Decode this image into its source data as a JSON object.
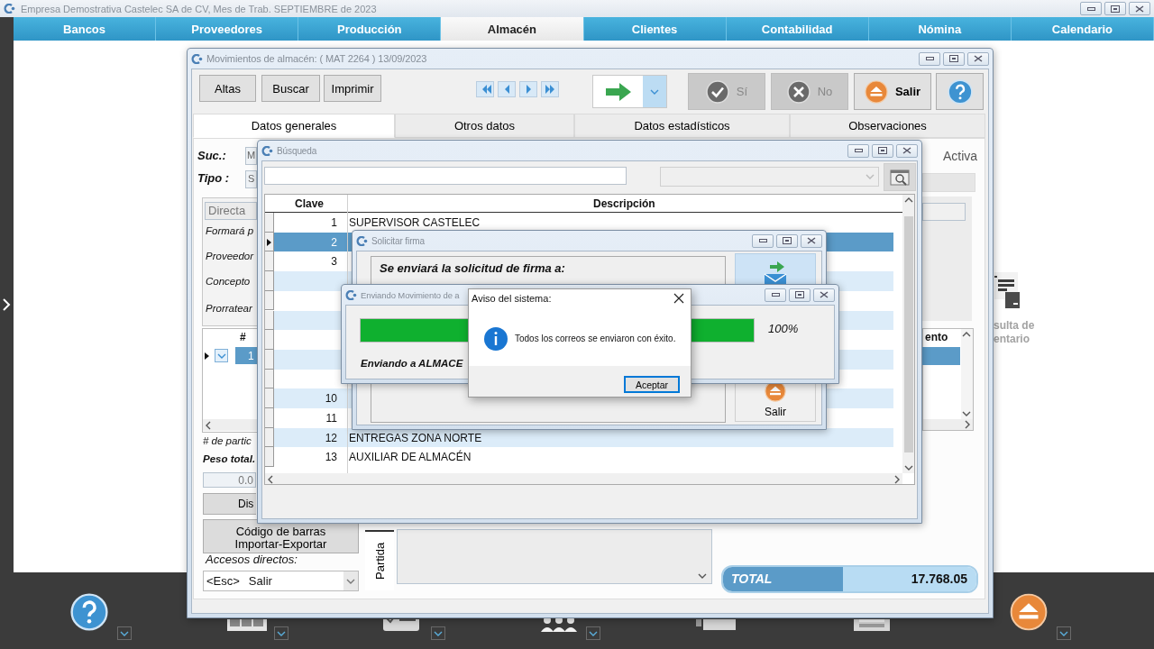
{
  "app_title": "Empresa Demostrativa Castelec SA de CV, Mes de Trab. SEPTIEMBRE de 2023",
  "menu": [
    {
      "label": "Bancos",
      "selected": false
    },
    {
      "label": "Proveedores",
      "selected": false
    },
    {
      "label": "Producción",
      "selected": false
    },
    {
      "label": "Almacén",
      "selected": true
    },
    {
      "label": "Clientes",
      "selected": false
    },
    {
      "label": "Contabilidad",
      "selected": false
    },
    {
      "label": "Nómina",
      "selected": false
    },
    {
      "label": "Calendario",
      "selected": false
    }
  ],
  "shortcut": {
    "lines": [
      "sulta de",
      "entario"
    ]
  },
  "main_window": {
    "title": "Movimientos de almacén: ( MAT 2264 )  13/09/2023",
    "toolbar": [
      "Altas",
      "Buscar",
      "Imprimir"
    ],
    "actions": [
      {
        "kind": "check",
        "label": "Sí",
        "disabled": true
      },
      {
        "kind": "cross",
        "label": "No",
        "disabled": true
      },
      {
        "kind": "eject",
        "label": "Salir",
        "disabled": false
      }
    ],
    "tabs": [
      {
        "label": "Datos generales",
        "selected": true
      },
      {
        "label": "Otros datos",
        "selected": false
      },
      {
        "label": "Datos estadísticos",
        "selected": false
      },
      {
        "label": "Observaciones",
        "selected": false
      }
    ],
    "suc": {
      "label": "Suc.:",
      "value": "M"
    },
    "tipo": {
      "label": "Tipo :",
      "value": "S"
    },
    "status": "Activa",
    "group": {
      "value": "Directa",
      "labels": [
        "Formará p",
        "Proveedor",
        "Concepto",
        "Prorratear"
      ]
    },
    "items_grid": {
      "columns": [
        "#",
        "ento"
      ],
      "rows": [
        {
          "number": "1",
          "selected": true,
          "checked": true
        }
      ]
    },
    "partidas_label": "# de partic",
    "peso_label": "Peso total.",
    "peso_value": "0.0",
    "dis_button": "Dis",
    "barcode_button": [
      "Código de barras",
      "Importar-Exportar"
    ],
    "shortcuts": {
      "label": "Accesos directos:",
      "key": "<Esc>",
      "action": "Salir"
    },
    "side_tab": "Partida",
    "total": {
      "label": "TOTAL",
      "value": "17.768.05"
    }
  },
  "search_window": {
    "title": "Búsqueda",
    "columns": [
      "Clave",
      "Descripción"
    ],
    "rows": [
      {
        "clave": "1",
        "descripcion": "SUPERVISOR CASTELEC",
        "selected": false
      },
      {
        "clave": "2",
        "selected": true
      },
      {
        "clave": "3",
        "selected": false
      },
      {
        "selected": false
      },
      {
        "selected": false
      },
      {
        "selected": false
      },
      {
        "selected": false
      },
      {
        "selected": false
      },
      {
        "selected": false
      },
      {
        "clave": "10",
        "selected": false
      },
      {
        "clave": "11",
        "selected": false
      },
      {
        "clave": "12",
        "descripcion": "ENTREGAS ZONA NORTE",
        "selected": false
      },
      {
        "clave": "13",
        "descripcion": "AUXILIAR DE ALMACÉN",
        "selected": false
      }
    ]
  },
  "sign_window": {
    "title": "Solicitar firma",
    "prompt": "Se enviará la solicitud de firma a:",
    "exit_label": "Salir"
  },
  "send_window": {
    "title": "Enviando Movimiento de a",
    "progress": {
      "level": 1,
      "reading": "100%"
    },
    "status": "Enviando a ALMACE"
  },
  "dialog": {
    "title": "Aviso del sistema:",
    "message": "Todos los correos se enviaron con éxito.",
    "button": "Aceptar"
  }
}
